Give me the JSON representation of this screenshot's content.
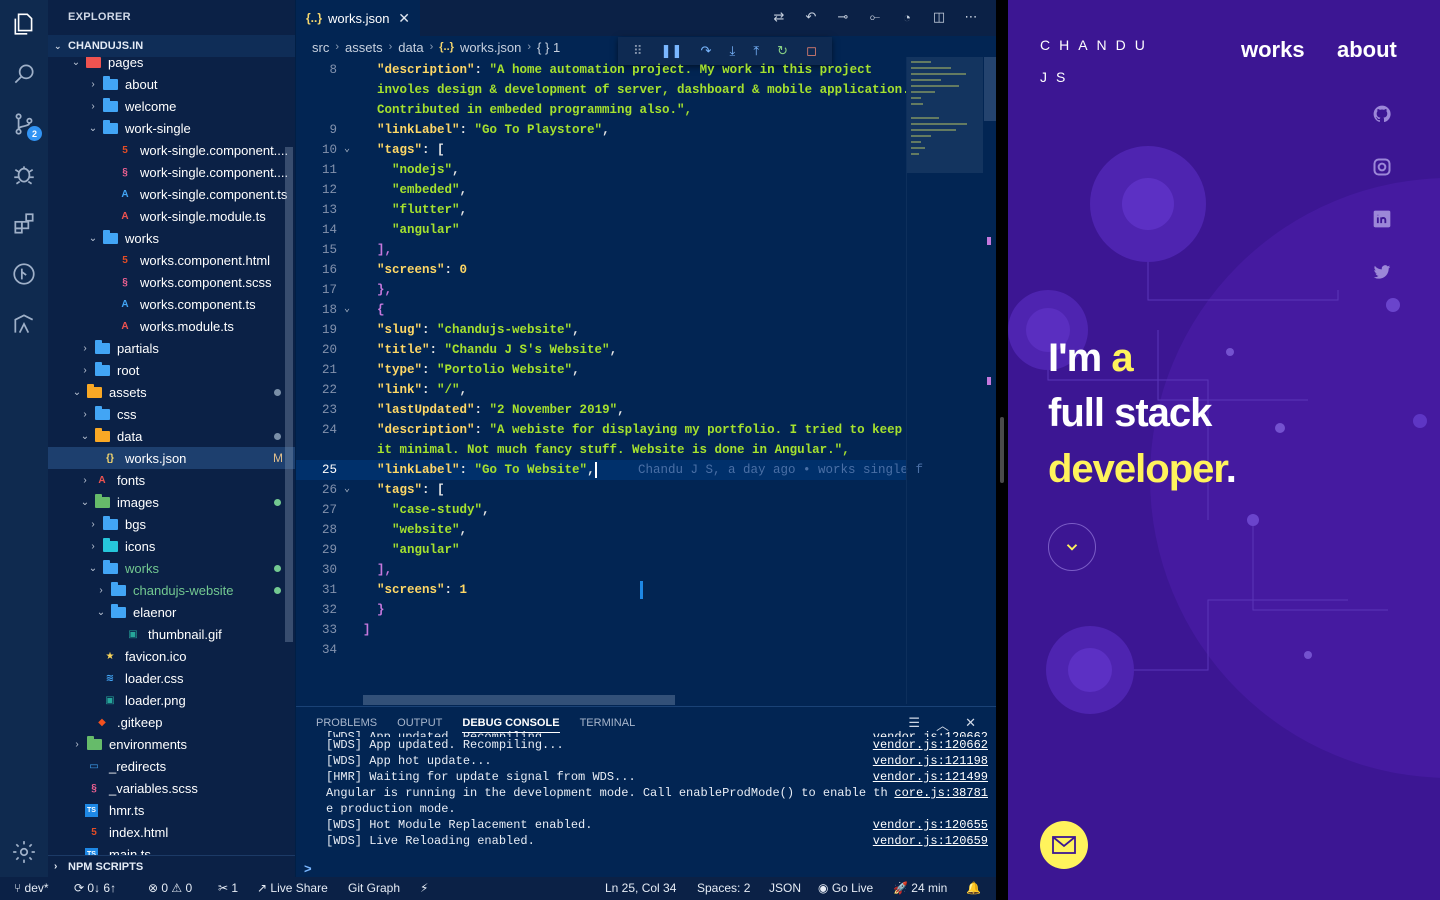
{
  "sidebar": {
    "header": "EXPLORER",
    "section": "CHANDUJS.IN",
    "npm": "NPM SCRIPTS",
    "items": [
      {
        "label": "pages",
        "kind": "folder-open"
      },
      {
        "label": "about",
        "kind": "folder"
      },
      {
        "label": "welcome",
        "kind": "folder"
      },
      {
        "label": "work-single",
        "kind": "folder-open"
      },
      {
        "label": "work-single.component....",
        "kind": "html"
      },
      {
        "label": "work-single.component....",
        "kind": "scss"
      },
      {
        "label": "work-single.component.ts",
        "kind": "ts"
      },
      {
        "label": "work-single.module.ts",
        "kind": "module"
      },
      {
        "label": "works",
        "kind": "folder-open"
      },
      {
        "label": "works.component.html",
        "kind": "html"
      },
      {
        "label": "works.component.scss",
        "kind": "scss"
      },
      {
        "label": "works.component.ts",
        "kind": "ts"
      },
      {
        "label": "works.module.ts",
        "kind": "module"
      },
      {
        "label": "partials",
        "kind": "folder"
      },
      {
        "label": "root",
        "kind": "folder"
      },
      {
        "label": "assets",
        "kind": "folder-open"
      },
      {
        "label": "css",
        "kind": "folder"
      },
      {
        "label": "data",
        "kind": "folder-open"
      },
      {
        "label": "works.json",
        "kind": "json",
        "status": "M"
      },
      {
        "label": "fonts",
        "kind": "folder"
      },
      {
        "label": "images",
        "kind": "folder-open"
      },
      {
        "label": "bgs",
        "kind": "folder"
      },
      {
        "label": "icons",
        "kind": "folder"
      },
      {
        "label": "works",
        "kind": "folder-open"
      },
      {
        "label": "chandujs-website",
        "kind": "folder"
      },
      {
        "label": "elaenor",
        "kind": "folder-open"
      },
      {
        "label": "thumbnail.gif",
        "kind": "image"
      },
      {
        "label": "favicon.ico",
        "kind": "star"
      },
      {
        "label": "loader.css",
        "kind": "css"
      },
      {
        "label": "loader.png",
        "kind": "image"
      },
      {
        "label": ".gitkeep",
        "kind": "git"
      },
      {
        "label": "environments",
        "kind": "folder"
      },
      {
        "label": "_redirects",
        "kind": "file"
      },
      {
        "label": "_variables.scss",
        "kind": "scss"
      },
      {
        "label": "hmr.ts",
        "kind": "tsfile"
      },
      {
        "label": "index.html",
        "kind": "html"
      },
      {
        "label": "main.ts",
        "kind": "tsfile"
      }
    ]
  },
  "editor": {
    "tab": "works.json",
    "breadcrumb": [
      "src",
      "assets",
      "data",
      "works.json",
      "{ } 1"
    ],
    "blame": "Chandu J S, a day ago • works single f",
    "lines": [
      {
        "n": "8",
        "code": "\"description\": \"A home automation project. My work in this project"
      },
      {
        "n": "",
        "code": "involes design & development of server, dashboard & mobile application."
      },
      {
        "n": "",
        "code": "Contributed in embeded programming also.\","
      },
      {
        "n": "9",
        "code": "\"linkLabel\": \"Go To Playstore\","
      },
      {
        "n": "10",
        "code": "\"tags\": ["
      },
      {
        "n": "11",
        "code": "  \"nodejs\","
      },
      {
        "n": "12",
        "code": "  \"embeded\","
      },
      {
        "n": "13",
        "code": "  \"flutter\","
      },
      {
        "n": "14",
        "code": "  \"angular\""
      },
      {
        "n": "15",
        "code": "],"
      },
      {
        "n": "16",
        "code": "\"screens\": 0"
      },
      {
        "n": "17",
        "code": "},"
      },
      {
        "n": "18",
        "code": "{"
      },
      {
        "n": "19",
        "code": "\"slug\": \"chandujs-website\","
      },
      {
        "n": "20",
        "code": "\"title\": \"Chandu J S's Website\","
      },
      {
        "n": "21",
        "code": "\"type\": \"Portolio Website\","
      },
      {
        "n": "22",
        "code": "\"link\": \"/\","
      },
      {
        "n": "23",
        "code": "\"lastUpdated\": \"2 November 2019\","
      },
      {
        "n": "24",
        "code": "\"description\": \"A webiste for displaying my portfolio. I tried to keep"
      },
      {
        "n": "",
        "code": "it minimal. Not much fancy stuff. Website is done in Angular.\","
      },
      {
        "n": "25",
        "code": "\"linkLabel\": \"Go To Website\","
      },
      {
        "n": "26",
        "code": "\"tags\": ["
      },
      {
        "n": "27",
        "code": "  \"case-study\","
      },
      {
        "n": "28",
        "code": "  \"website\","
      },
      {
        "n": "29",
        "code": "  \"angular\""
      },
      {
        "n": "30",
        "code": "],"
      },
      {
        "n": "31",
        "code": "\"screens\": 1"
      },
      {
        "n": "32",
        "code": "}"
      },
      {
        "n": "33",
        "code": "]"
      },
      {
        "n": "34",
        "code": ""
      }
    ]
  },
  "panel": {
    "tabs": [
      "PROBLEMS",
      "OUTPUT",
      "DEBUG CONSOLE",
      "TERMINAL"
    ],
    "active_tab": "DEBUG CONSOLE",
    "console": [
      {
        "text": "[WDS] App updated. Recompiling...",
        "src": "vendor.js:120662"
      },
      {
        "text": "[WDS] App updated. Recompiling...",
        "src": "vendor.js:120662"
      },
      {
        "text": "[WDS] App hot update...",
        "src": "vendor.js:121198"
      },
      {
        "text": "[HMR] Waiting for update signal from WDS...",
        "src": "vendor.js:121499"
      },
      {
        "text": "Angular is running in the development mode. Call enableProdMode() to enable th",
        "src": "core.js:38781"
      },
      {
        "text": "e production mode.",
        "src": ""
      },
      {
        "text": "[WDS] Hot Module Replacement enabled.",
        "src": "vendor.js:120655"
      },
      {
        "text": "[WDS] Live Reloading enabled.",
        "src": "vendor.js:120659"
      }
    ],
    "prompt": ">"
  },
  "statusbar": {
    "branch": "dev*",
    "sync": "0↓ 6↑",
    "errors": "0",
    "warnings": "0",
    "info": "1",
    "liveshare": "Live Share",
    "gitgraph": "Git Graph",
    "position": "Ln 25, Col 34",
    "spaces": "Spaces: 2",
    "language": "JSON",
    "golive": "Go Live",
    "time": "24 min"
  },
  "preview": {
    "logo_line1": "CHANDU",
    "logo_line2": "JS",
    "nav": [
      "works",
      "about"
    ],
    "hero_line1_a": "I'm",
    "hero_line1_b": "a",
    "hero_line2": "full stack",
    "hero_line3": "developer",
    "hero_dot": ".",
    "colors": {
      "bg": "#3c1693",
      "accent": "#fff35c"
    }
  }
}
